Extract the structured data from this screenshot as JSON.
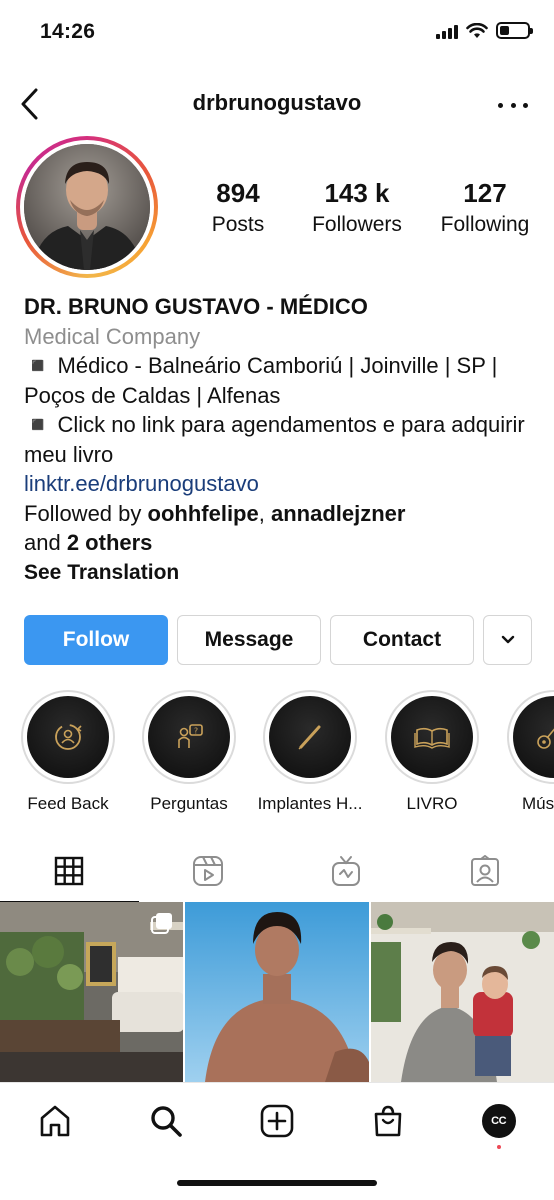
{
  "status": {
    "time": "14:26"
  },
  "header": {
    "username": "drbrunogustavo"
  },
  "stats": [
    {
      "value": "894",
      "label": "Posts"
    },
    {
      "value": "143 k",
      "label": "Followers"
    },
    {
      "value": "127",
      "label": "Following"
    }
  ],
  "bio": {
    "name": "DR. BRUNO GUSTAVO - MÉDICO",
    "category": "Medical Company",
    "line1": "◾️ Médico - Balneário Camboriú | Joinville | SP | Poços de Caldas | Alfenas",
    "line2": "◾️ Click no link para agendamentos e para adquirir meu livro",
    "link": "linktr.ee/drbrunogustavo",
    "followed_prefix": "Followed by ",
    "followed_user1": "oohhfelipe",
    "followed_sep": ", ",
    "followed_user2": "annadlejzner",
    "followed_and": " and ",
    "followed_others": "2 others",
    "see_translation": "See Translation"
  },
  "actions": {
    "follow": "Follow",
    "message": "Message",
    "contact": "Contact"
  },
  "highlights": [
    {
      "label": "Feed Back",
      "icon": "feedback-icon"
    },
    {
      "label": "Perguntas",
      "icon": "question-person-icon"
    },
    {
      "label": "Implantes H...",
      "icon": "pen-icon"
    },
    {
      "label": "LIVRO",
      "icon": "book-icon"
    },
    {
      "label": "Mús",
      "icon": "guitar-icon"
    }
  ],
  "tabs": [
    "grid-icon",
    "reels-icon",
    "igtv-icon",
    "tagged-icon"
  ],
  "nav": {
    "items": [
      "home-icon",
      "search-icon",
      "create-icon",
      "shop-icon",
      "profile-avatar"
    ],
    "avatar_text": "CC"
  },
  "colors": {
    "follow_button": "#3b97f1",
    "link": "#1a3d7a",
    "category": "#8e8e8e",
    "notification_dot": "#ed4956"
  }
}
